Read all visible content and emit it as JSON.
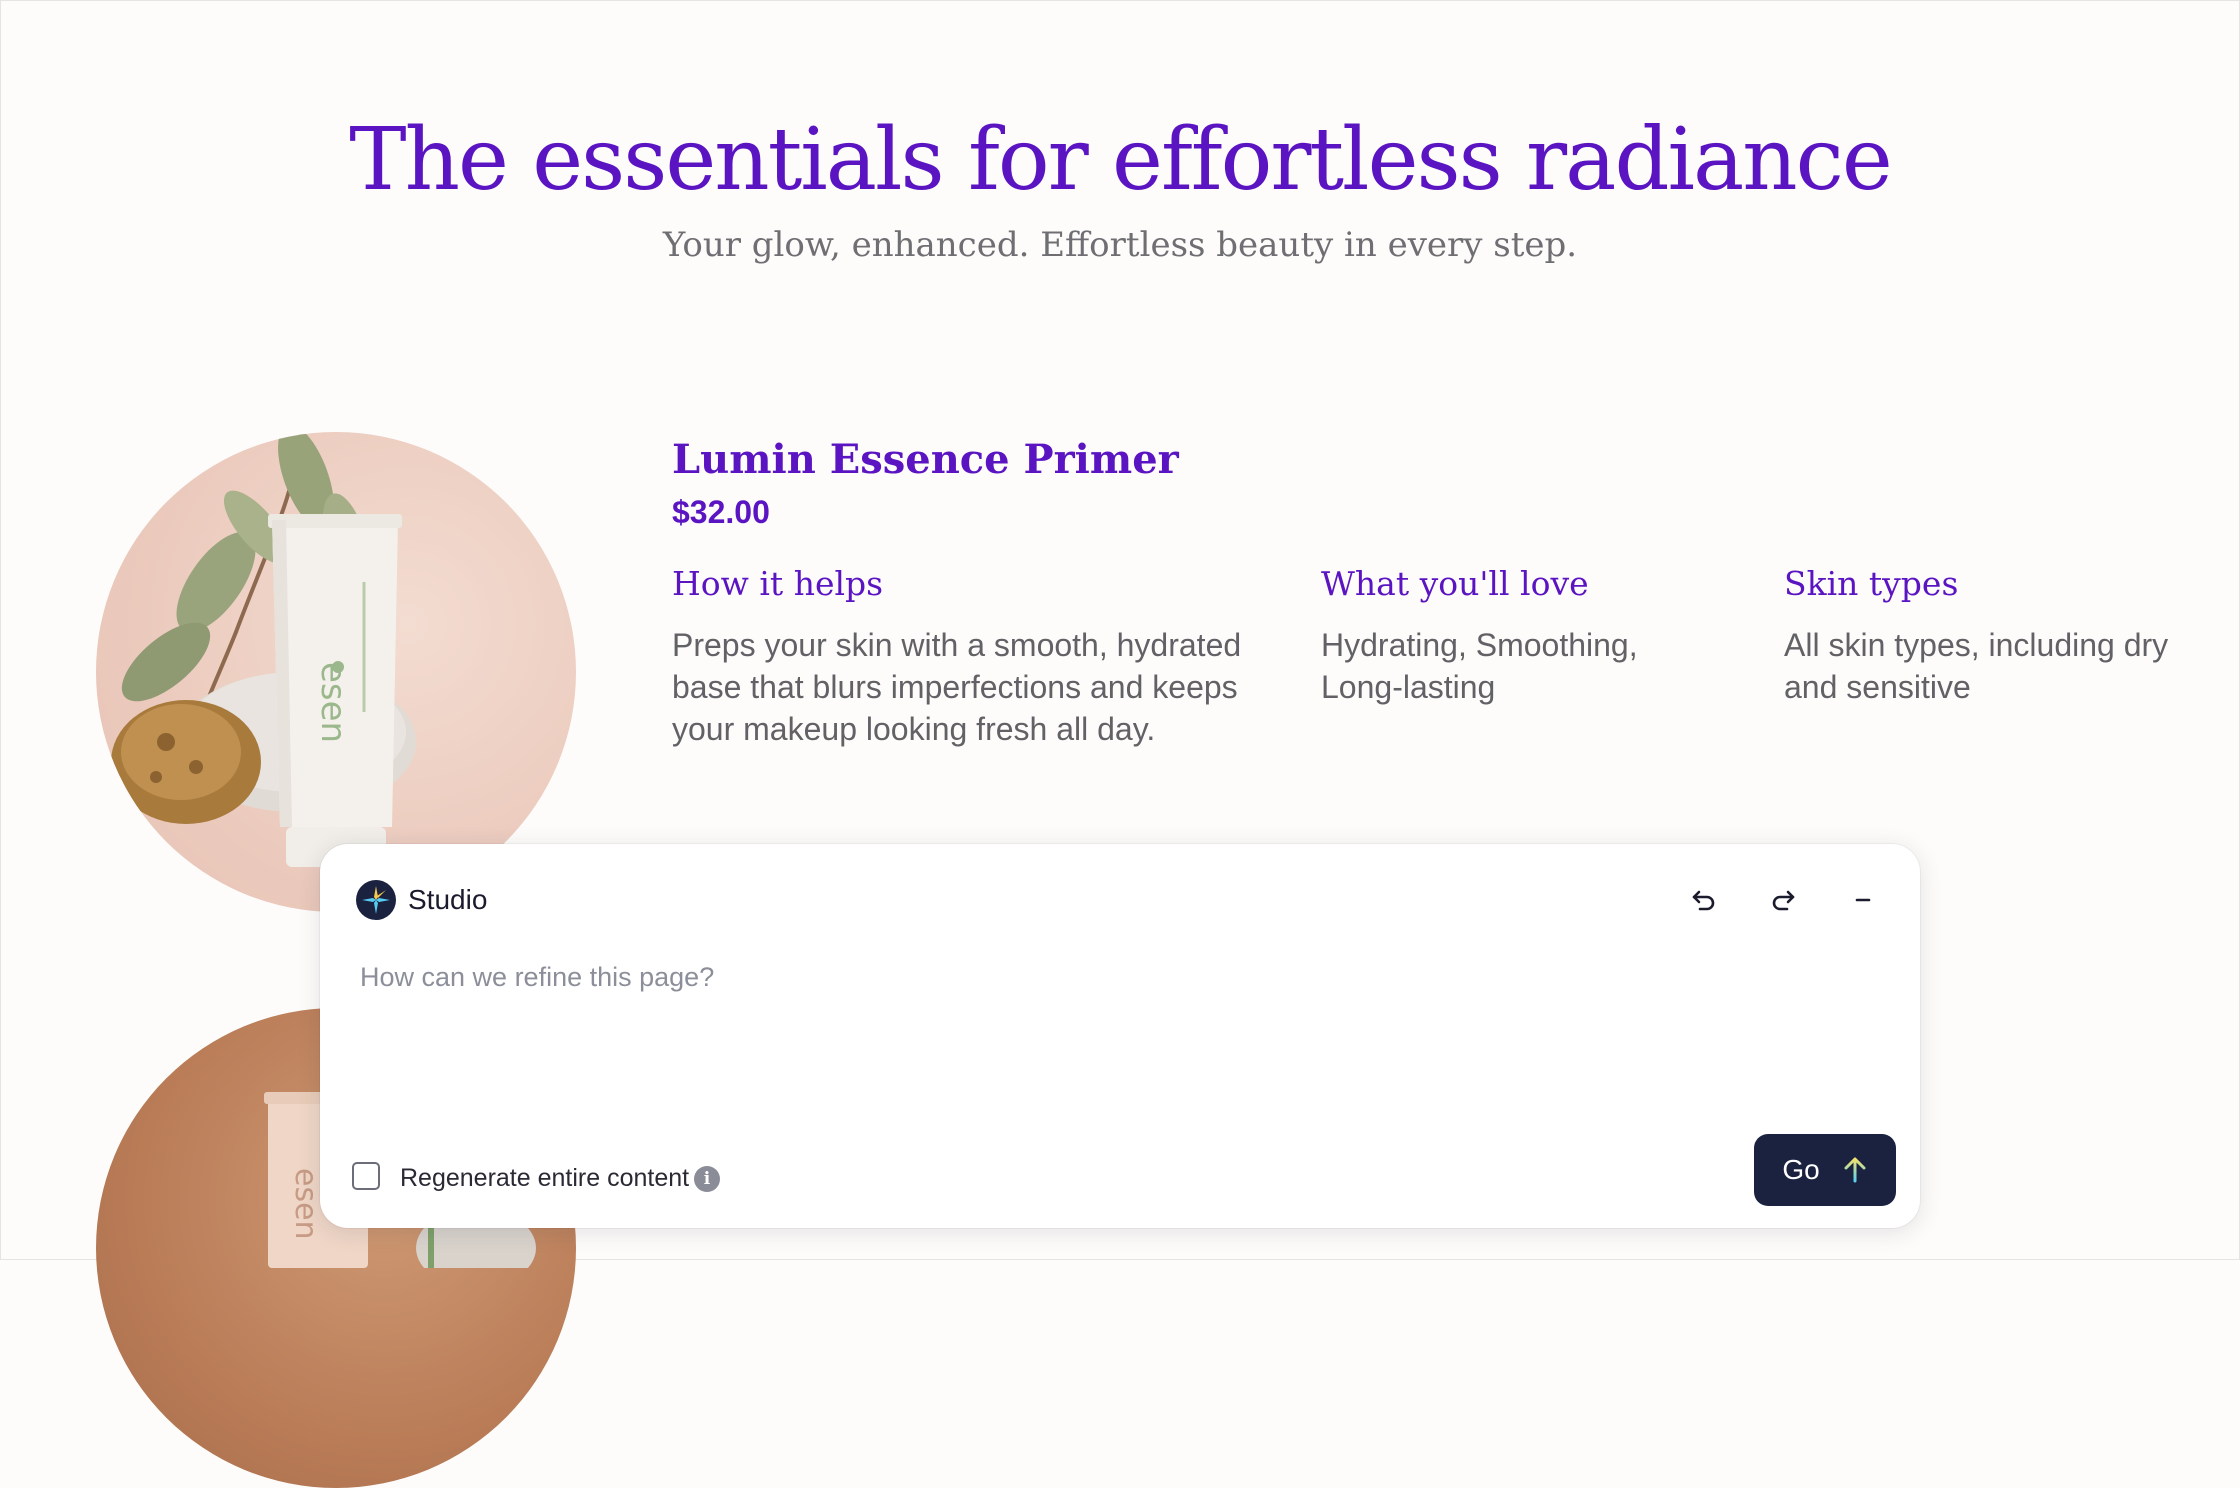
{
  "hero": {
    "title": "The essentials for effortless radiance",
    "subtitle": "Your glow, enhanced. Effortless beauty in every step."
  },
  "product": {
    "name": "Lumin Essence Primer",
    "price": "$32.00",
    "brand_text": "esen",
    "columns": [
      {
        "heading": "How it helps",
        "body": "Preps your skin with a smooth, hydrated base that blurs imperfections and keeps your makeup looking fresh all day."
      },
      {
        "heading": "What you'll love",
        "body": "Hydrating, Smoothing, Long-lasting"
      },
      {
        "heading": "Skin types",
        "body": "All skin types, including dry and sensitive"
      }
    ]
  },
  "studio": {
    "title": "Studio",
    "placeholder": "How can we refine this page?",
    "regenerate_label": "Regenerate entire content",
    "regenerate_checked": false,
    "go_label": "Go",
    "icons": [
      "undo-icon",
      "redo-icon",
      "minimize-icon",
      "info-icon",
      "arrow-up-icon"
    ]
  },
  "colors": {
    "accent": "#5b14c2",
    "button": "#1b2240",
    "background": "#fdfcfa"
  }
}
